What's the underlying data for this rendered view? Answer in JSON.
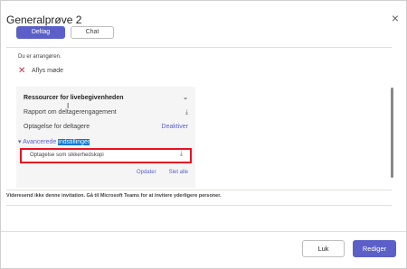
{
  "dialog": {
    "title": "Generalprøve 2",
    "close_icon": "×"
  },
  "tabs": {
    "primary_label": "Deltag",
    "secondary_label": "Chat"
  },
  "organizer_note": "Du er arrangøren.",
  "cancel_meeting": {
    "icon": "✕",
    "label": "Aflys møde"
  },
  "resources": {
    "header": "Ressourcer for livebegivenheden",
    "chevron": "⌄",
    "rows": [
      {
        "label": "Rapport om deltagerengagement",
        "icon": "⤓"
      },
      {
        "label": "Optagelse for deltagere",
        "action": "Deaktiver"
      }
    ],
    "advanced": {
      "arrow": "▾",
      "prefix": "Avancerede ",
      "highlighted": "indstillinger"
    },
    "backup_recording": {
      "label": "Optagelse som sikkerhedskopi",
      "icon": "⤓"
    },
    "actions": {
      "update": "Opdater",
      "delete_all": "Slet alle"
    }
  },
  "warning": "Videresend ikke denne invitation. Gå til Microsoft Teams for at invitere yderligere personer.",
  "footer": {
    "close_label": "Luk",
    "save_label": "Rediger"
  },
  "colors": {
    "accent": "#5b5fc7",
    "highlight": "#e81123"
  }
}
